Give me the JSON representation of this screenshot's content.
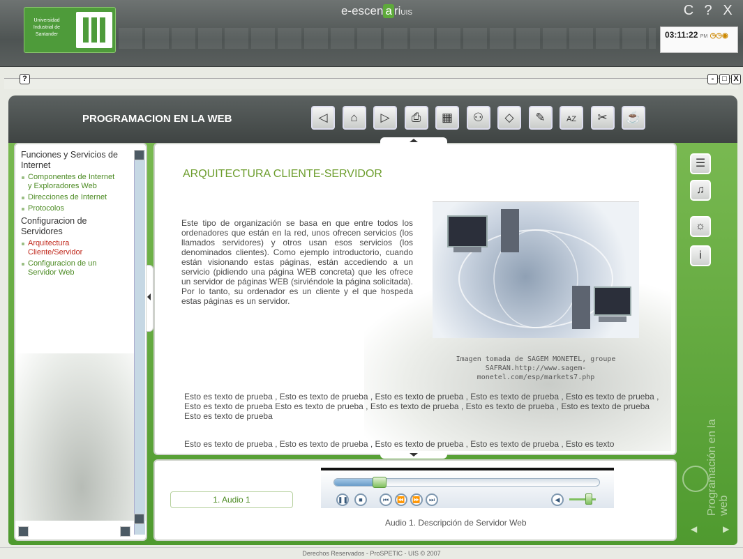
{
  "logo": {
    "text": "Universidad Industrial de Santander"
  },
  "app": {
    "title_prefix": "e-escen",
    "title_mid": "a",
    "title_suffix": "ri",
    "title_sub": "UIS"
  },
  "window_controls": {
    "minimize": "C",
    "help": "?",
    "close": "X"
  },
  "clock": {
    "time": "03:11:22",
    "ampm": "PM"
  },
  "subbar": {
    "help": "?",
    "btn_min": "-",
    "btn_max": "□",
    "btn_close": "X"
  },
  "course": {
    "title": "PROGRAMACION EN LA WEB"
  },
  "toolbar": [
    {
      "name": "back",
      "glyph": "◁"
    },
    {
      "name": "home",
      "glyph": "⌂"
    },
    {
      "name": "forward",
      "glyph": "▷"
    },
    {
      "name": "print",
      "glyph": "⎙"
    },
    {
      "name": "calculator",
      "glyph": "▦"
    },
    {
      "name": "people",
      "glyph": "⚇"
    },
    {
      "name": "eraser",
      "glyph": "◇"
    },
    {
      "name": "notes",
      "glyph": "✎"
    },
    {
      "name": "glossary",
      "glyph": "AZ"
    },
    {
      "name": "tools",
      "glyph": "✂"
    },
    {
      "name": "coffee",
      "glyph": "☕"
    }
  ],
  "sidebar": {
    "sections": [
      {
        "heading": "Funciones y Servicios de Internet",
        "items": [
          {
            "label": "Componentes de Internet y Exploradores Web"
          },
          {
            "label": "Direcciones de Internet"
          },
          {
            "label": "Protocolos"
          }
        ]
      },
      {
        "heading": "Configuracion de Servidores",
        "items": [
          {
            "label": "Arquitectura Cliente/Servidor",
            "active": true
          },
          {
            "label": "Configuracion de un Servidor Web"
          }
        ]
      }
    ]
  },
  "content": {
    "title": "ARQUITECTURA CLIENTE-SERVIDOR",
    "paragraph1": "Este tipo de organización se basa en que entre todos los ordenadores que están en la red, unos ofrecen servicios (los llamados servidores) y otros usan esos servicios (los denominados clientes). Como ejemplo introductorio, cuando están visionando estas páginas, están accediendo a un servicio (pidiendo una página WEB concreta) que les ofrece un servidor de páginas WEB (sirviéndole la página solicitada). Por lo tanto, su ordenador es un cliente y el que hospeda estas páginas es un servidor.",
    "caption": "Imagen tomada de SAGEM MONETEL, groupe SAFRAN.http://www.sagem-monetel.com/esp/markets7.php",
    "paragraph2": "Esto es texto de prueba , Esto es texto de prueba , Esto es texto de prueba , Esto es texto de prueba , Esto es texto de prueba , Esto es texto de prueba Esto es texto de prueba , Esto es texto de prueba , Esto es texto de prueba , Esto es texto de prueba Esto es texto de prueba",
    "paragraph3": "Esto es texto de prueba , Esto es texto de prueba , Esto es texto de prueba , Esto es texto de prueba , Esto es texto"
  },
  "side_tools": [
    {
      "name": "document",
      "glyph": "☰"
    },
    {
      "name": "audio",
      "glyph": "♫"
    },
    {
      "name": "image",
      "glyph": "☼"
    },
    {
      "name": "info",
      "glyph": "i"
    }
  ],
  "watermark": {
    "line1": "Programación",
    "line2": "en la web"
  },
  "audio": {
    "track_label": "1. Audio 1",
    "description": "Audio 1. Descripción de Servidor Web",
    "progress": 0.17,
    "volume": 0.6
  },
  "footer": {
    "text": "Derechos Reservados - ProSPETIC - UIS © 2007"
  },
  "colors": {
    "accent_green": "#5ea93b",
    "link_green": "#4b8a22",
    "active_red": "#c0271a"
  }
}
